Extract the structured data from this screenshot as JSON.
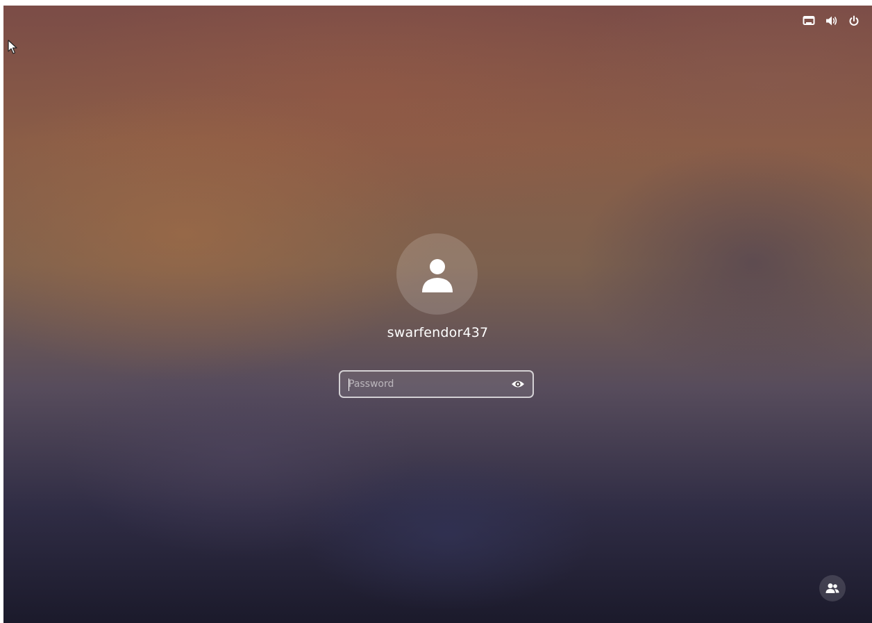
{
  "top_bar": {
    "icons": [
      "network-wired-icon",
      "volume-icon",
      "power-icon"
    ]
  },
  "login": {
    "username": "swarfendor437",
    "password_placeholder": "Password",
    "password_value": ""
  },
  "bottom": {
    "switch_user_icon": "users-icon"
  },
  "colors": {
    "text": "#ffffff",
    "field_border": "#d9d6dc"
  }
}
